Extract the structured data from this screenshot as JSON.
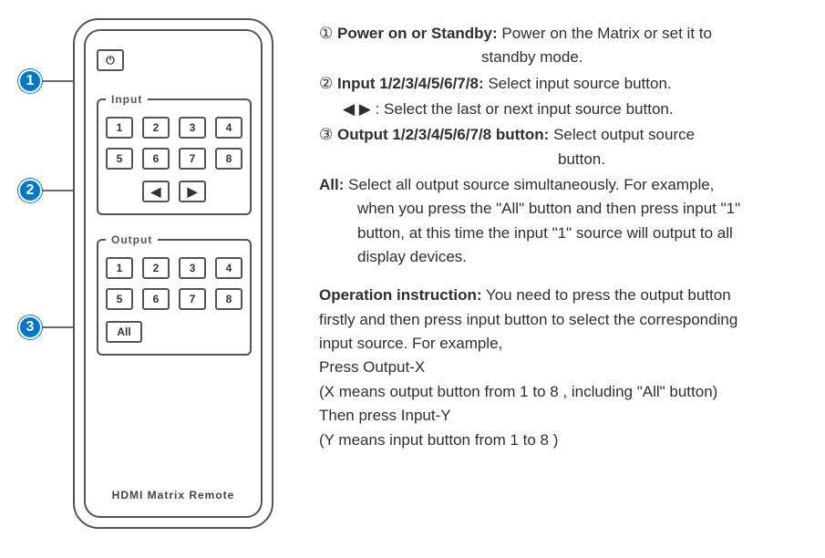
{
  "callouts": {
    "c1": "1",
    "c2": "2",
    "c3": "3"
  },
  "remote": {
    "input_legend": "Input",
    "output_legend": "Output",
    "buttons": {
      "b1": "1",
      "b2": "2",
      "b3": "3",
      "b4": "4",
      "b5": "5",
      "b6": "6",
      "b7": "7",
      "b8": "8"
    },
    "arrow_left": "◀",
    "arrow_right": "▶",
    "all": "All",
    "label": "HDMI Matrix Remote",
    "power_icon": "⏻"
  },
  "desc": {
    "n1": "①",
    "n2": "②",
    "n3": "③",
    "t1_label": "Power on or Standby:",
    "t1_text_a": " Power on the Matrix or set it to",
    "t1_text_b": "standby mode.",
    "t2_label": "Input 1/2/3/4/5/6/7/8:",
    "t2_text": " Select input source button.",
    "t2b_arrows": "◀  ▶",
    "t2b_text": "  : Select the last or next input source button.",
    "t3_label": "Output 1/2/3/4/5/6/7/8 button:",
    "t3_text_a": " Select output source",
    "t3_text_b": "button.",
    "all_label": "All:",
    "all_text_a": " Select all output source simultaneously. For example,",
    "all_text_b": "when you press the \"All\" button and then press input \"1\"",
    "all_text_c": "button, at this time the input \"1\" source will output to all",
    "all_text_d": "display devices.",
    "op_label": "Operation instruction:",
    "op_text_a": " You need to press the output button",
    "op_text_b": "firstly and then press input button to select the corresponding",
    "op_text_c": "input source. For example,",
    "op_text_d": "Press Output-X",
    "op_text_e": "(X means output button from 1 to 8 , including \"All\" button)",
    "op_text_f": "Then press Input-Y",
    "op_text_g": "(Y means input button from 1 to 8 )"
  }
}
